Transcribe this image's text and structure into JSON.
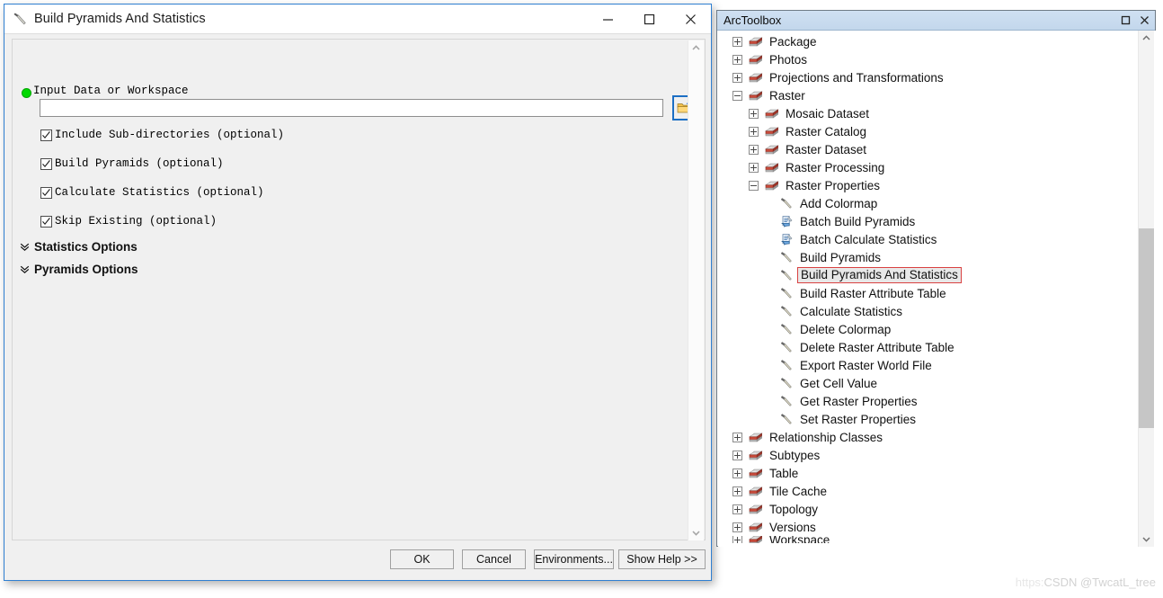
{
  "dialog": {
    "title": "Build Pyramids And Statistics",
    "title_icon": "hammer-tool-icon",
    "window_controls": {
      "minimize": "–",
      "maximize": "□",
      "close": "✕"
    },
    "input_param": {
      "label": "Input Data or Workspace",
      "value": "",
      "placeholder": "",
      "required_marker": "green-dot",
      "browse_icon": "open-folder-icon"
    },
    "checkboxes": [
      {
        "label": "Include Sub-directories (optional)",
        "checked": true
      },
      {
        "label": "Build Pyramids (optional)",
        "checked": true
      },
      {
        "label": "Calculate Statistics (optional)",
        "checked": true
      },
      {
        "label": "Skip Existing (optional)",
        "checked": true
      }
    ],
    "expanders": [
      {
        "label": "Statistics Options",
        "expanded": false
      },
      {
        "label": "Pyramids Options",
        "expanded": false
      }
    ],
    "buttons": [
      {
        "label": "OK"
      },
      {
        "label": "Cancel"
      },
      {
        "label": "Environments..."
      },
      {
        "label": "Show Help >>"
      }
    ]
  },
  "toolbox": {
    "title": "ArcToolbox",
    "window_controls": {
      "maximize": "□",
      "close": "✕"
    },
    "tree": [
      {
        "label": "Package",
        "icon": "toolbox-icon",
        "indent": 0,
        "state": "plus"
      },
      {
        "label": "Photos",
        "icon": "toolbox-icon",
        "indent": 0,
        "state": "plus"
      },
      {
        "label": "Projections and Transformations",
        "icon": "toolbox-icon",
        "indent": 0,
        "state": "plus"
      },
      {
        "label": "Raster",
        "icon": "toolbox-icon",
        "indent": 0,
        "state": "minus"
      },
      {
        "label": "Mosaic Dataset",
        "icon": "toolbox-icon",
        "indent": 1,
        "state": "plus"
      },
      {
        "label": "Raster Catalog",
        "icon": "toolbox-icon",
        "indent": 1,
        "state": "plus"
      },
      {
        "label": "Raster Dataset",
        "icon": "toolbox-icon",
        "indent": 1,
        "state": "plus"
      },
      {
        "label": "Raster Processing",
        "icon": "toolbox-icon",
        "indent": 1,
        "state": "plus"
      },
      {
        "label": "Raster Properties",
        "icon": "toolbox-icon",
        "indent": 1,
        "state": "minus"
      },
      {
        "label": "Add Colormap",
        "icon": "hammer-tool-icon",
        "indent": 2,
        "state": "none"
      },
      {
        "label": "Batch Build Pyramids",
        "icon": "batch-script-icon",
        "indent": 2,
        "state": "none"
      },
      {
        "label": "Batch Calculate Statistics",
        "icon": "batch-script-icon",
        "indent": 2,
        "state": "none"
      },
      {
        "label": "Build Pyramids",
        "icon": "hammer-tool-icon",
        "indent": 2,
        "state": "none"
      },
      {
        "label": "Build Pyramids And Statistics",
        "icon": "hammer-tool-icon",
        "indent": 2,
        "state": "none",
        "selected": true
      },
      {
        "label": "Build Raster Attribute Table",
        "icon": "hammer-tool-icon",
        "indent": 2,
        "state": "none"
      },
      {
        "label": "Calculate Statistics",
        "icon": "hammer-tool-icon",
        "indent": 2,
        "state": "none"
      },
      {
        "label": "Delete Colormap",
        "icon": "hammer-tool-icon",
        "indent": 2,
        "state": "none"
      },
      {
        "label": "Delete Raster Attribute Table",
        "icon": "hammer-tool-icon",
        "indent": 2,
        "state": "none"
      },
      {
        "label": "Export Raster World File",
        "icon": "hammer-tool-icon",
        "indent": 2,
        "state": "none"
      },
      {
        "label": "Get Cell Value",
        "icon": "hammer-tool-icon",
        "indent": 2,
        "state": "none"
      },
      {
        "label": "Get Raster Properties",
        "icon": "hammer-tool-icon",
        "indent": 2,
        "state": "none"
      },
      {
        "label": "Set Raster Properties",
        "icon": "hammer-tool-icon",
        "indent": 2,
        "state": "none"
      },
      {
        "label": "Relationship Classes",
        "icon": "toolbox-icon",
        "indent": 0,
        "state": "plus"
      },
      {
        "label": "Subtypes",
        "icon": "toolbox-icon",
        "indent": 0,
        "state": "plus"
      },
      {
        "label": "Table",
        "icon": "toolbox-icon",
        "indent": 0,
        "state": "plus"
      },
      {
        "label": "Tile Cache",
        "icon": "toolbox-icon",
        "indent": 0,
        "state": "plus"
      },
      {
        "label": "Topology",
        "icon": "toolbox-icon",
        "indent": 0,
        "state": "plus"
      },
      {
        "label": "Versions",
        "icon": "toolbox-icon",
        "indent": 0,
        "state": "plus"
      },
      {
        "label": "Workspace",
        "icon": "toolbox-icon",
        "indent": 0,
        "state": "plus",
        "clipped": true
      }
    ]
  },
  "watermark": {
    "url_text": "https:",
    "text": "CSDN @TwcatL_tree"
  },
  "colors": {
    "dialog_border": "#2f7fd1",
    "panel_title_bg": "#c8daee",
    "selection_border": "#d94141",
    "selection_bg": "#e8e8e8",
    "required_dot": "#00d900"
  }
}
